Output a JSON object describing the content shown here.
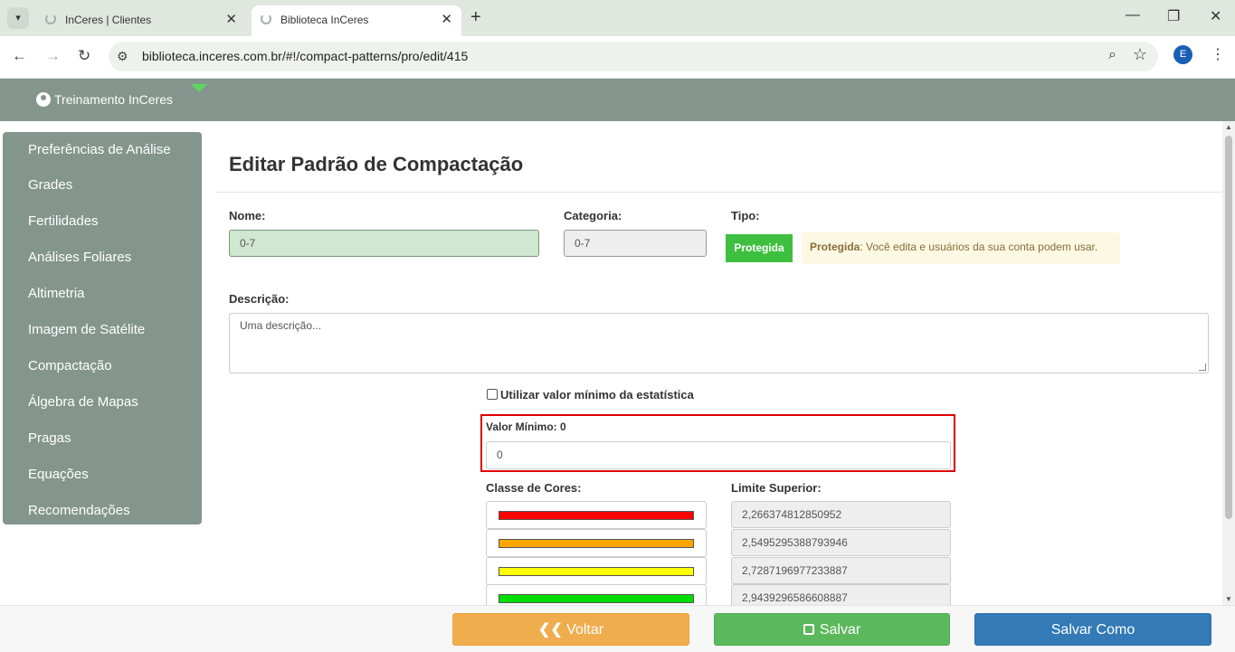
{
  "browser": {
    "tabs": [
      {
        "title": "InCeres | Clientes"
      },
      {
        "title": "Biblioteca InCeres"
      }
    ],
    "url": "biblioteca.inceres.com.br/#!/compact-patterns/pro/edit/415",
    "profile_initial": "E"
  },
  "header": {
    "user": "Treinamento InCeres"
  },
  "sidebar": {
    "items": [
      {
        "label": "Preferências de Análise"
      },
      {
        "label": "Grades"
      },
      {
        "label": "Fertilidades"
      },
      {
        "label": "Análises Foliares"
      },
      {
        "label": "Altimetria"
      },
      {
        "label": "Imagem de Satélite"
      },
      {
        "label": "Compactação"
      },
      {
        "label": "Álgebra de Mapas"
      },
      {
        "label": "Pragas"
      },
      {
        "label": "Equações"
      },
      {
        "label": "Recomendações"
      }
    ]
  },
  "form": {
    "title": "Editar Padrão de Compactação",
    "nome_label": "Nome:",
    "nome_value": "0-7",
    "categoria_label": "Categoria:",
    "categoria_value": "0-7",
    "tipo_label": "Tipo:",
    "tipo_badge": "Protegida",
    "tipo_note_strong": "Protegida",
    "tipo_note_text": ": Você edita e usuários da sua conta podem usar.",
    "descricao_label": "Descrição:",
    "descricao_placeholder": "Uma descrição...",
    "checkbox_label": "Utilizar valor mínimo da estatística",
    "checkbox_checked": false,
    "valor_minimo_label": "Valor Mínimo: 0",
    "valor_minimo_value": "0",
    "classe_label": "Classe de Cores:",
    "limite_label": "Limite Superior:",
    "classes": [
      {
        "color": "#ff0000",
        "limite": "2,266374812850952"
      },
      {
        "color": "#ffa500",
        "limite": "2,5495295388793946"
      },
      {
        "color": "#ffff00",
        "limite": "2,7287196977233887"
      },
      {
        "color": "#00dd00",
        "limite": "2,9439296586608887"
      }
    ]
  },
  "footer": {
    "back_label": "Voltar",
    "save_label": "Salvar",
    "saveas_label": "Salvar Como"
  }
}
